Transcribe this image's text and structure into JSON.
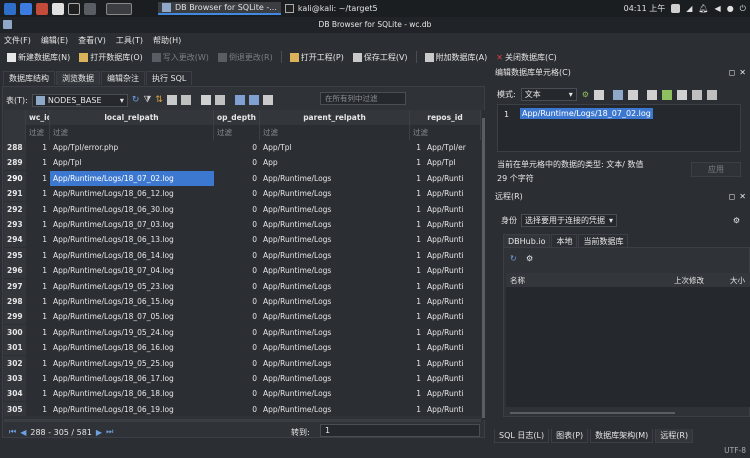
{
  "panel": {
    "tasks": [
      "DB Browser for SQLite -...",
      "kali@kali: ~/target5"
    ],
    "clock": "04:11 上午"
  },
  "window": {
    "title": "DB Browser for SQLite - wc.db"
  },
  "menu": [
    "文件(F)",
    "编辑(E)",
    "查看(V)",
    "工具(T)",
    "帮助(H)"
  ],
  "toolbar": {
    "new_db": "新建数据库(N)",
    "open_db": "打开数据库(O)",
    "write_changes": "写入更改(W)",
    "revert_changes": "倒退更改(R)",
    "open_project": "打开工程(P)",
    "save_project": "保存工程(V)",
    "attach_db": "附加数据库(A)",
    "close_db": "关闭数据库(C)"
  },
  "left_tabs": [
    "数据库结构",
    "浏览数据",
    "编辑杂注",
    "执行 SQL"
  ],
  "browse": {
    "table_label": "表(T):",
    "table_name": "NODES_BASE",
    "filter_all_placeholder": "在所有列中过滤",
    "columns": [
      "wc_id",
      "local_relpath",
      "op_depth",
      "parent_relpath",
      "repos_id"
    ],
    "filter_text": "过滤",
    "rows": [
      {
        "n": "288",
        "wc_id": "1",
        "local_relpath": "App/Tpl/error.php",
        "op_depth": "0",
        "parent_relpath": "App/Tpl",
        "repos_id": "1",
        "extra": "App/Tpl/er"
      },
      {
        "n": "289",
        "wc_id": "1",
        "local_relpath": "App/Tpl",
        "op_depth": "0",
        "parent_relpath": "App",
        "repos_id": "1",
        "extra": "App/Tpl"
      },
      {
        "n": "290",
        "wc_id": "1",
        "local_relpath": "App/Runtime/Logs/18_07_02.log",
        "op_depth": "0",
        "parent_relpath": "App/Runtime/Logs",
        "repos_id": "1",
        "extra": "App/Runti"
      },
      {
        "n": "291",
        "wc_id": "1",
        "local_relpath": "App/Runtime/Logs/18_06_12.log",
        "op_depth": "0",
        "parent_relpath": "App/Runtime/Logs",
        "repos_id": "1",
        "extra": "App/Runti"
      },
      {
        "n": "292",
        "wc_id": "1",
        "local_relpath": "App/Runtime/Logs/18_06_30.log",
        "op_depth": "0",
        "parent_relpath": "App/Runtime/Logs",
        "repos_id": "1",
        "extra": "App/Runti"
      },
      {
        "n": "293",
        "wc_id": "1",
        "local_relpath": "App/Runtime/Logs/18_07_03.log",
        "op_depth": "0",
        "parent_relpath": "App/Runtime/Logs",
        "repos_id": "1",
        "extra": "App/Runti"
      },
      {
        "n": "294",
        "wc_id": "1",
        "local_relpath": "App/Runtime/Logs/18_06_13.log",
        "op_depth": "0",
        "parent_relpath": "App/Runtime/Logs",
        "repos_id": "1",
        "extra": "App/Runti"
      },
      {
        "n": "295",
        "wc_id": "1",
        "local_relpath": "App/Runtime/Logs/18_06_14.log",
        "op_depth": "0",
        "parent_relpath": "App/Runtime/Logs",
        "repos_id": "1",
        "extra": "App/Runti"
      },
      {
        "n": "296",
        "wc_id": "1",
        "local_relpath": "App/Runtime/Logs/18_07_04.log",
        "op_depth": "0",
        "parent_relpath": "App/Runtime/Logs",
        "repos_id": "1",
        "extra": "App/Runti"
      },
      {
        "n": "297",
        "wc_id": "1",
        "local_relpath": "App/Runtime/Logs/19_05_23.log",
        "op_depth": "0",
        "parent_relpath": "App/Runtime/Logs",
        "repos_id": "1",
        "extra": "App/Runti"
      },
      {
        "n": "298",
        "wc_id": "1",
        "local_relpath": "App/Runtime/Logs/18_06_15.log",
        "op_depth": "0",
        "parent_relpath": "App/Runtime/Logs",
        "repos_id": "1",
        "extra": "App/Runti"
      },
      {
        "n": "299",
        "wc_id": "1",
        "local_relpath": "App/Runtime/Logs/18_07_05.log",
        "op_depth": "0",
        "parent_relpath": "App/Runtime/Logs",
        "repos_id": "1",
        "extra": "App/Runti"
      },
      {
        "n": "300",
        "wc_id": "1",
        "local_relpath": "App/Runtime/Logs/19_05_24.log",
        "op_depth": "0",
        "parent_relpath": "App/Runtime/Logs",
        "repos_id": "1",
        "extra": "App/Runti"
      },
      {
        "n": "301",
        "wc_id": "1",
        "local_relpath": "App/Runtime/Logs/18_06_16.log",
        "op_depth": "0",
        "parent_relpath": "App/Runtime/Logs",
        "repos_id": "1",
        "extra": "App/Runti"
      },
      {
        "n": "302",
        "wc_id": "1",
        "local_relpath": "App/Runtime/Logs/19_05_25.log",
        "op_depth": "0",
        "parent_relpath": "App/Runtime/Logs",
        "repos_id": "1",
        "extra": "App/Runti"
      },
      {
        "n": "303",
        "wc_id": "1",
        "local_relpath": "App/Runtime/Logs/18_06_17.log",
        "op_depth": "0",
        "parent_relpath": "App/Runtime/Logs",
        "repos_id": "1",
        "extra": "App/Runti"
      },
      {
        "n": "304",
        "wc_id": "1",
        "local_relpath": "App/Runtime/Logs/18_06_18.log",
        "op_depth": "0",
        "parent_relpath": "App/Runtime/Logs",
        "repos_id": "1",
        "extra": "App/Runti"
      },
      {
        "n": "305",
        "wc_id": "1",
        "local_relpath": "App/Runtime/Logs/18_06_19.log",
        "op_depth": "0",
        "parent_relpath": "App/Runtime/Logs",
        "repos_id": "1",
        "extra": "App/Runti"
      }
    ],
    "selected_row": "290",
    "record_range": "288 - 305 / 581",
    "goto_label": "转到:",
    "goto_value": "1"
  },
  "cell_editor": {
    "title": "编辑数据库单元格(C)",
    "mode_label": "模式:",
    "mode_value": "文本",
    "line_number": "1",
    "content": "App/Runtime/Logs/18_07_02.log",
    "type_info": "当前在单元格中的数据的类型: 文本/ 数值",
    "size_info": "29 个字符",
    "apply": "应用"
  },
  "remote": {
    "title": "远程(R)",
    "identity_label": "身份",
    "identity_value": "选择要用于连接的凭据",
    "tabs": [
      "DBHub.io",
      "本地",
      "当前数据库"
    ],
    "columns": [
      "名称",
      "上次修改",
      "大小"
    ]
  },
  "bottom_tabs": [
    "SQL 日志(L)",
    "图表(P)",
    "数据库架构(M)",
    "远程(R)"
  ],
  "status": {
    "encoding": "UTF-8"
  },
  "colors": {
    "accent": "#3d78d0",
    "background": "#2b2e33",
    "close_red": "#e04040"
  }
}
